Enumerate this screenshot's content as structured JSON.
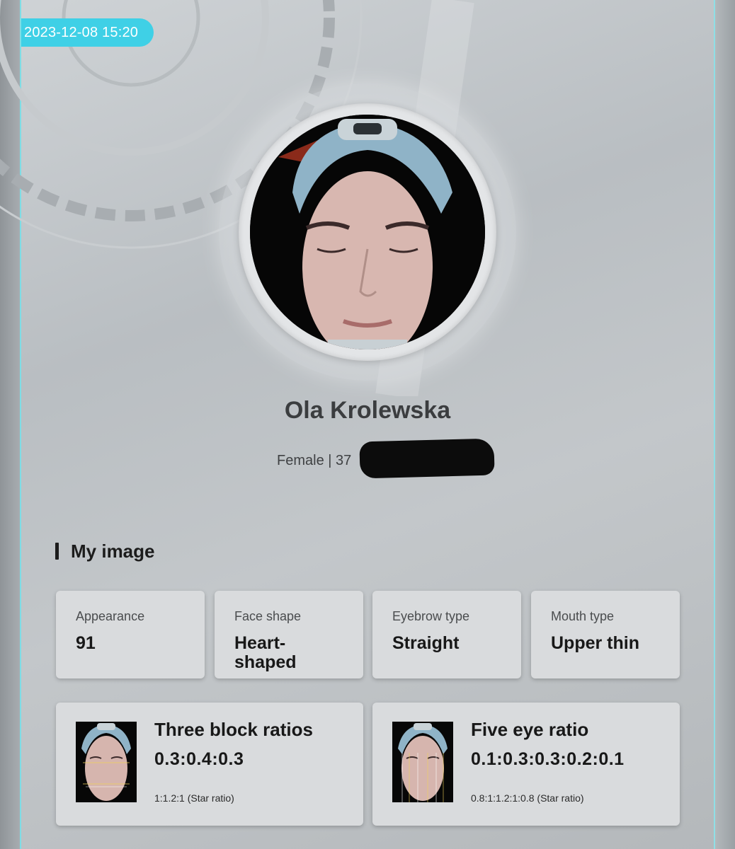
{
  "header": {
    "timestamp": "2023-12-08 15:20"
  },
  "profile": {
    "name": "Ola Krolewska",
    "gender_age": "Female | 37"
  },
  "section": {
    "title": "My image"
  },
  "attributes": [
    {
      "label": "Appearance",
      "value": "91"
    },
    {
      "label": "Face shape",
      "value": "Heart-shaped"
    },
    {
      "label": "Eyebrow type",
      "value": "Straight"
    },
    {
      "label": "Mouth type",
      "value": "Upper thin"
    }
  ],
  "ratios": [
    {
      "title": "Three block ratios",
      "value": "0.3:0.4:0.3",
      "reference": "1:1.2:1 (Star ratio)"
    },
    {
      "title": "Five eye ratio",
      "value": "0.1:0.3:0.3:0.2:0.1",
      "reference": "0.8:1:1.2:1:0.8 (Star ratio)"
    }
  ],
  "colors": {
    "accent": "#3fd0e6",
    "frame_edge": "#7fdde5"
  }
}
